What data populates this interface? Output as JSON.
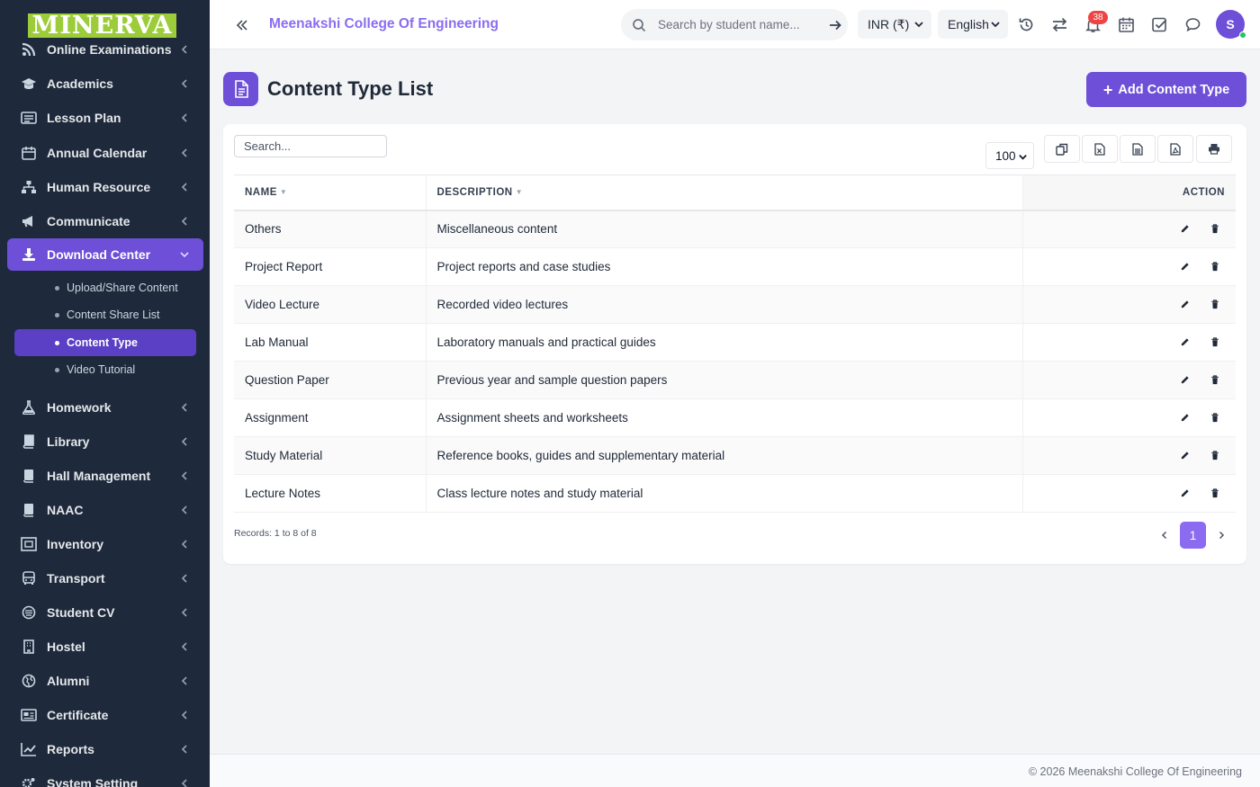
{
  "brand": {
    "logo_text": "MINERVA"
  },
  "sidebar": {
    "items": [
      {
        "label": "Online Examinations",
        "icon": "rss-icon"
      },
      {
        "label": "Academics",
        "icon": "graduation-cap-icon"
      },
      {
        "label": "Lesson Plan",
        "icon": "list-alt-icon"
      },
      {
        "label": "Annual Calendar",
        "icon": "calendar-icon"
      },
      {
        "label": "Human Resource",
        "icon": "sitemap-icon"
      },
      {
        "label": "Communicate",
        "icon": "bullhorn-icon"
      },
      {
        "label": "Download Center",
        "icon": "download-icon"
      },
      {
        "label": "Homework",
        "icon": "flask-icon"
      },
      {
        "label": "Library",
        "icon": "book-icon"
      },
      {
        "label": "Hall Management",
        "icon": "book-open-icon"
      },
      {
        "label": "NAAC",
        "icon": "book-closed-icon"
      },
      {
        "label": "Inventory",
        "icon": "inventory-icon"
      },
      {
        "label": "Transport",
        "icon": "bus-icon"
      },
      {
        "label": "Student CV",
        "icon": "id-card-icon"
      },
      {
        "label": "Hostel",
        "icon": "building-icon"
      },
      {
        "label": "Alumni",
        "icon": "globe-icon"
      },
      {
        "label": "Certificate",
        "icon": "certificate-icon"
      },
      {
        "label": "Reports",
        "icon": "line-chart-icon"
      },
      {
        "label": "System Setting",
        "icon": "gears-icon"
      }
    ],
    "subitems": [
      {
        "label": "Upload/Share Content"
      },
      {
        "label": "Content Share List"
      },
      {
        "label": "Content Type"
      },
      {
        "label": "Video Tutorial"
      }
    ]
  },
  "header": {
    "college_name": "Meenakshi College Of Engineering",
    "search_placeholder": "Search by student name...",
    "currency": "INR (₹)",
    "language": "English",
    "notification_count": "38",
    "avatar_initial": "S"
  },
  "page": {
    "title": "Content Type List",
    "add_button": "Add Content Type"
  },
  "table": {
    "search_placeholder": "Search...",
    "page_length": "100",
    "columns": {
      "name": "NAME",
      "description": "DESCRIPTION",
      "action": "ACTION"
    },
    "rows": [
      {
        "name": "Others",
        "description": "Miscellaneous content"
      },
      {
        "name": "Project Report",
        "description": "Project reports and case studies"
      },
      {
        "name": "Video Lecture",
        "description": "Recorded video lectures"
      },
      {
        "name": "Lab Manual",
        "description": "Laboratory manuals and practical guides"
      },
      {
        "name": "Question Paper",
        "description": "Previous year and sample question papers"
      },
      {
        "name": "Assignment",
        "description": "Assignment sheets and worksheets"
      },
      {
        "name": "Study Material",
        "description": "Reference books, guides and supplementary material"
      },
      {
        "name": "Lecture Notes",
        "description": "Class lecture notes and study material"
      }
    ],
    "records_text": "Records: 1 to 8 of 8",
    "current_page": "1"
  },
  "footer": {
    "copyright": "© 2026 Meenakshi College Of Engineering"
  },
  "colors": {
    "sidebar_bg": "#1e2a3b",
    "accent": "#6d4fd8",
    "accent_light": "#8b6cf0",
    "badge": "#ef4444"
  }
}
